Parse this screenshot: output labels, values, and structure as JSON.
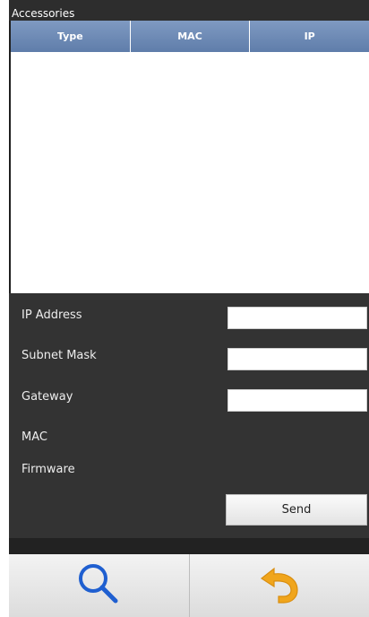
{
  "title": "Accessories",
  "table": {
    "columns": [
      "Type",
      "MAC",
      "IP"
    ],
    "rows": []
  },
  "form": {
    "ip_label": "IP Address",
    "ip_value": "",
    "subnet_label": "Subnet Mask",
    "subnet_value": "",
    "gateway_label": "Gateway",
    "gateway_value": "",
    "mac_label": "MAC",
    "firmware_label": "Firmware",
    "send_label": "Send"
  },
  "nav": {
    "search_icon": "magnifier-icon",
    "back_icon": "undo-arrow-icon"
  },
  "colors": {
    "header_blue": "#6f8bb7",
    "panel_dark": "#333333",
    "arrow_orange": "#f0a51c",
    "magnifier_blue": "#1f5fd0"
  }
}
